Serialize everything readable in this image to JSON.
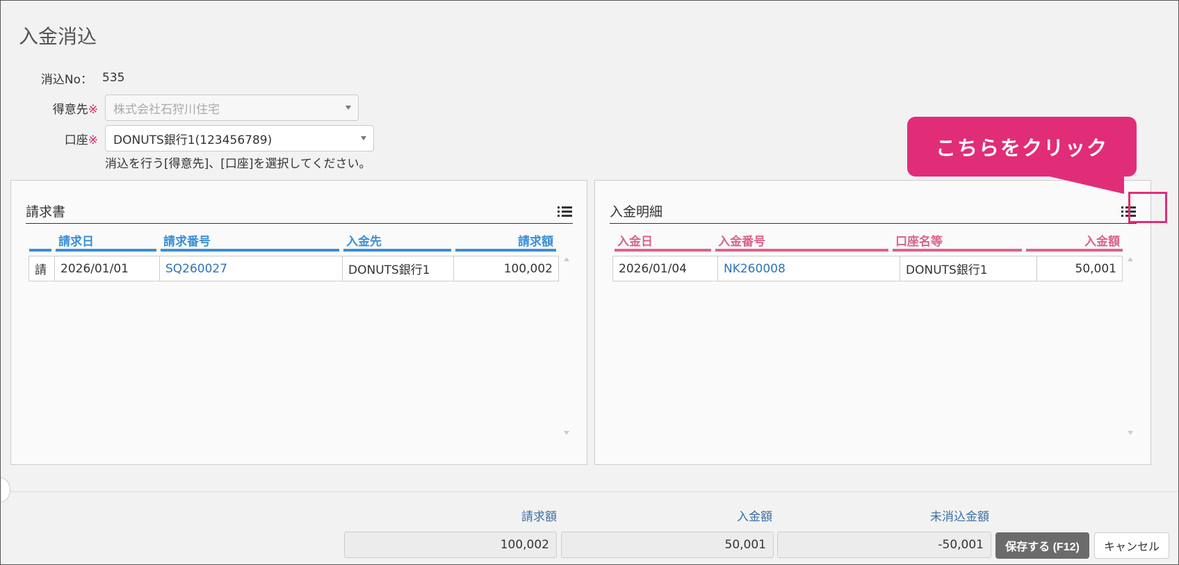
{
  "page": {
    "title": "入金消込"
  },
  "form": {
    "no_label": "消込No：",
    "no_value": "535",
    "customer_label": "得意先",
    "customer_required": "※",
    "customer_value": "株式会社石狩川住宅",
    "account_label": "口座",
    "account_required": "※",
    "account_value": "DONUTS銀行1(123456789)",
    "hint": "消込を行う[得意先]、[口座]を選択してください。"
  },
  "invoice_panel": {
    "title": "請求書",
    "columns": [
      "請求日",
      "請求番号",
      "入金先",
      "請求額"
    ],
    "rows": [
      {
        "mark": "請",
        "date": "2026/01/01",
        "number": "SQ260027",
        "payee": "DONUTS銀行1",
        "amount": "100,002"
      }
    ]
  },
  "deposit_panel": {
    "title": "入金明細",
    "columns": [
      "入金日",
      "入金番号",
      "口座名等",
      "入金額"
    ],
    "rows": [
      {
        "date": "2026/01/04",
        "number": "NK260008",
        "account": "DONUTS銀行1",
        "amount": "50,001"
      }
    ]
  },
  "callout": {
    "text": "こちらをクリック",
    "color": "#e12d78"
  },
  "summary": {
    "invoice_label": "請求額",
    "invoice_value": "100,002",
    "deposit_label": "入金額",
    "deposit_value": "50,001",
    "unapplied_label": "未消込金額",
    "unapplied_value": "-50,001"
  },
  "buttons": {
    "save": "保存する (F12)",
    "cancel": "キャンセル"
  },
  "colors": {
    "blue": "#3a8fd6",
    "pink": "#d9638b",
    "accent": "#e12d78"
  }
}
